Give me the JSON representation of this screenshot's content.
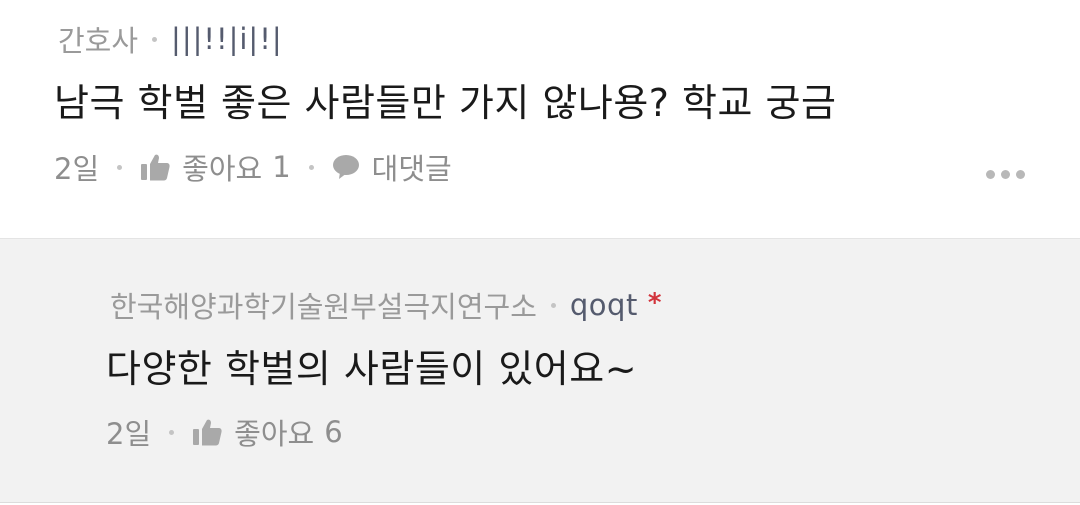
{
  "post": {
    "category": "간호사",
    "author": "|||!!|i|!|",
    "text": "남극 학벌 좋은 사람들만 가지 않나용? 학교 궁금",
    "time": "2일",
    "like_label": "좋아요",
    "like_count": "1",
    "reply_label": "대댓글"
  },
  "reply": {
    "company": "한국해양과학기술원부설극지연구소",
    "author": "qoqt",
    "badge": "*",
    "text": "다양한 학벌의 사람들이 있어요~",
    "time": "2일",
    "like_label": "좋아요",
    "like_count": "6"
  },
  "icons": {
    "like": "thumbs-up-icon",
    "reply": "speech-bubble-icon",
    "more": "more-horizontal-icon"
  },
  "colors": {
    "reply_background": "#f2f2f2",
    "badge": "#d2343c",
    "nickname": "#555b6e"
  }
}
